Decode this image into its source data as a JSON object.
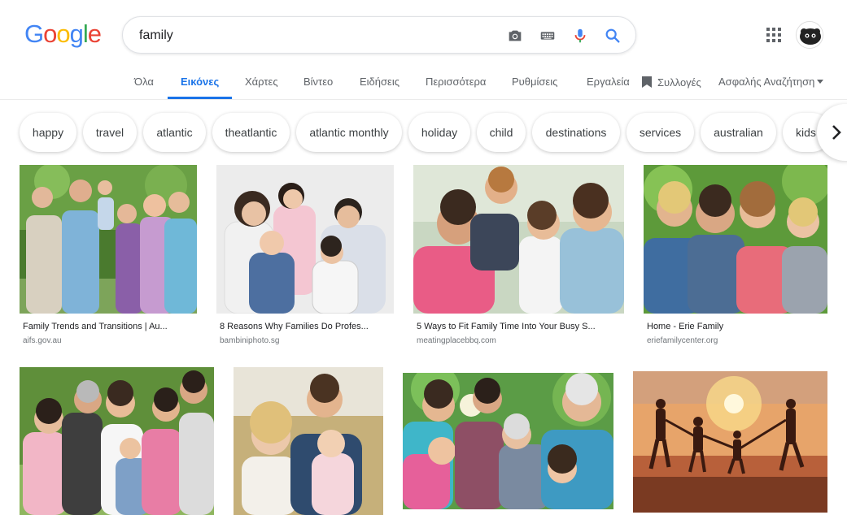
{
  "logo": {
    "letters": [
      "G",
      "o",
      "o",
      "g",
      "l",
      "e"
    ],
    "colors": [
      "#4285F4",
      "#EA4335",
      "#FBBC05",
      "#4285F4",
      "#34A853",
      "#EA4335"
    ]
  },
  "search": {
    "value": "family",
    "icons": [
      "camera-icon",
      "keyboard-icon",
      "mic-icon",
      "search-icon"
    ]
  },
  "header_icons": [
    "apps-icon",
    "avatar"
  ],
  "tabs": [
    {
      "label": "Όλα",
      "active": false
    },
    {
      "label": "Εικόνες",
      "active": true
    },
    {
      "label": "Χάρτες",
      "active": false
    },
    {
      "label": "Βίντεο",
      "active": false
    },
    {
      "label": "Ειδήσεις",
      "active": false
    },
    {
      "label": "Περισσότερα",
      "active": false
    },
    {
      "label": "Ρυθμίσεις",
      "active": false
    },
    {
      "label": "Εργαλεία",
      "active": false
    },
    {
      "label": "Συλλογές",
      "active": false,
      "icon": "bookmark-icon"
    },
    {
      "label": "Ασφαλής Αναζήτηση",
      "active": false,
      "icon": "dropdown-arrow-icon"
    }
  ],
  "chips": [
    "happy",
    "travel",
    "atlantic",
    "theatlantic",
    "atlantic monthly",
    "holiday",
    "child",
    "destinations",
    "services",
    "australian",
    "kids"
  ],
  "results": [
    {
      "title": "Family Trends and Transitions | Au...",
      "source": "aifs.gov.au"
    },
    {
      "title": "8 Reasons Why Families Do Profes...",
      "source": "bambiniphoto.sg"
    },
    {
      "title": "5 Ways to Fit Family Time Into Your Busy S...",
      "source": "meatingplacebbq.com"
    },
    {
      "title": "Home - Erie Family",
      "source": "eriefamilycenter.org"
    },
    {
      "title": "",
      "source": ""
    },
    {
      "title": "",
      "source": ""
    },
    {
      "title": "",
      "source": ""
    },
    {
      "title": "",
      "source": ""
    }
  ],
  "colors": {
    "accent": "#1a73e8",
    "tab_text": "#5f6368",
    "source_text": "#70757a"
  }
}
